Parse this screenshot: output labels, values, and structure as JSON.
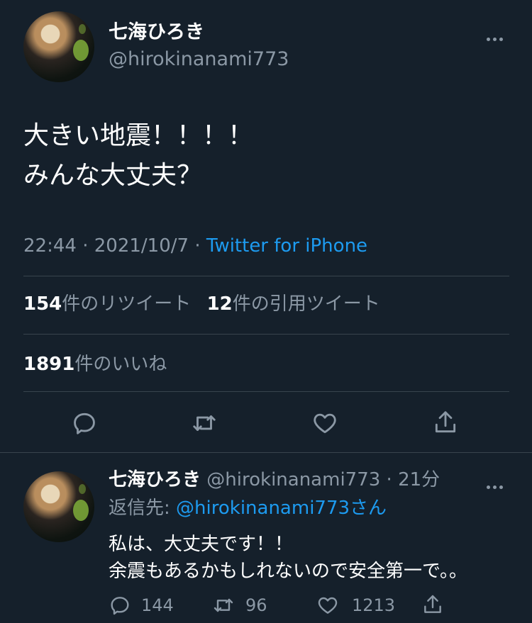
{
  "tweet": {
    "display_name": "七海ひろき",
    "handle": "@hirokinanami773",
    "text_line1": "大きい地震！！！！",
    "text_line2": "みんな大丈夫？",
    "time": "22:44",
    "sep1": " · ",
    "date": "2021/10/7",
    "sep2": " · ",
    "client": "Twitter for iPhone",
    "retweets": {
      "count": "154",
      "label": "件のリツイート"
    },
    "quotes": {
      "count": "12",
      "label": "件の引用ツイート"
    },
    "likes": {
      "count": "1891",
      "label": "件のいいね"
    }
  },
  "reply": {
    "display_name": "七海ひろき",
    "handle": "@hirokinanami773",
    "separator": " · ",
    "time_ago": "21分",
    "reply_to_prefix": "返信先: ",
    "reply_to_handle": "@hirokinanami773さん",
    "text_line1": "私は、大丈夫です！！",
    "text_line2": "余震もあるかもしれないので安全第一で。。",
    "reply_count": "144",
    "retweet_count": "96",
    "like_count": "1213"
  },
  "colors": {
    "background": "#15202b",
    "text": "#ffffff",
    "muted": "#8b98a5",
    "link": "#1d9bf0",
    "divider": "#38444d"
  },
  "icons": [
    "more-icon",
    "reply-icon",
    "retweet-icon",
    "like-icon",
    "share-icon"
  ]
}
